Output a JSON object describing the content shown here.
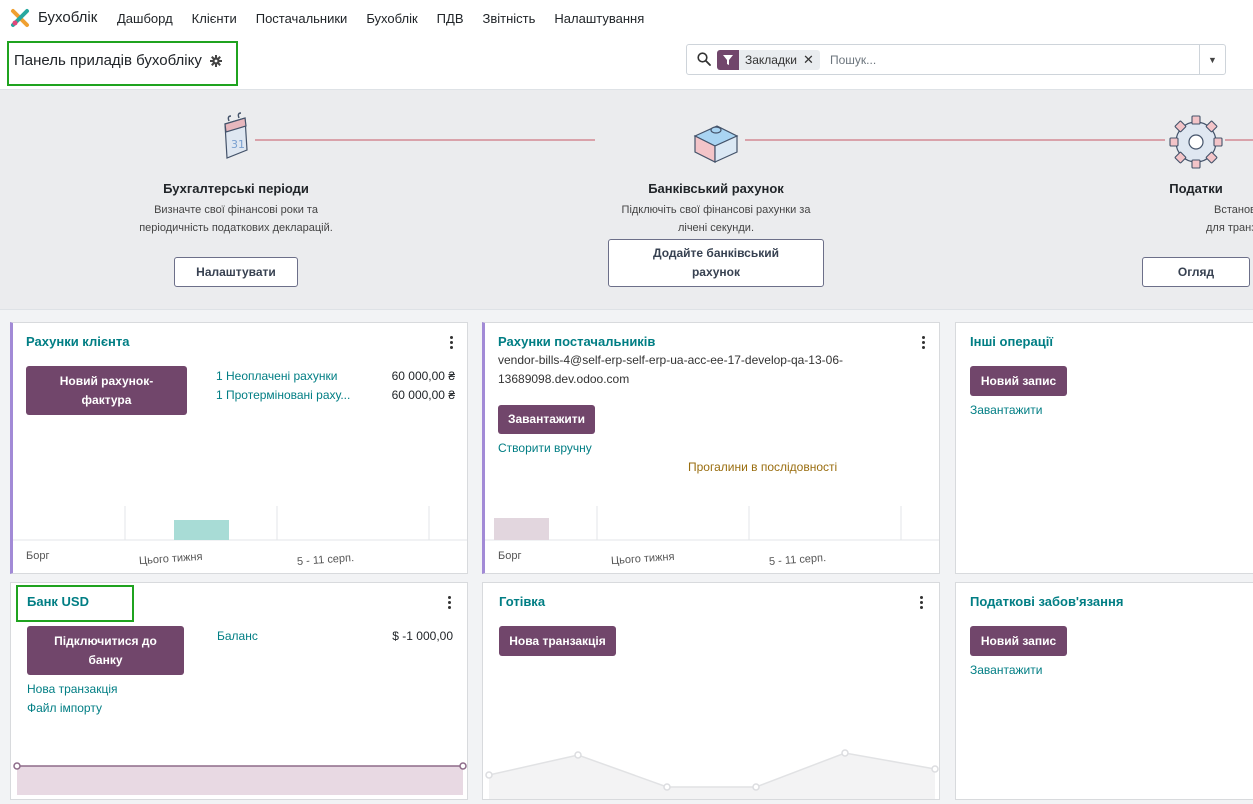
{
  "app": {
    "name": "Бухоблік",
    "menu": [
      "Дашборд",
      "Клієнти",
      "Постачальники",
      "Бухоблік",
      "ПДВ",
      "Звітність",
      "Налаштування"
    ]
  },
  "control": {
    "title": "Панель приладів бухобліку",
    "facet_label": "Закладки",
    "search_placeholder": "Пошук..."
  },
  "onboarding": {
    "steps": [
      {
        "title": "Бухгалтерські періоди",
        "desc1": "Визначте свої фінансові роки та",
        "desc2": "періодичність податкових декларацій.",
        "button": "Налаштувати",
        "icon": "calendar-icon"
      },
      {
        "title": "Банківський рахунок",
        "desc1": "Підключіть свої фінансові рахунки за",
        "desc2": "лічені секунди.",
        "button1": "Додайте банківський",
        "button2": "рахунок",
        "icon": "puzzle-icon"
      },
      {
        "title": "Податки",
        "desc1": "Встановіть податки за замовч",
        "desc2": "для транзакцій продажів та за",
        "button": "Огляд",
        "icon": "gear-icon"
      }
    ]
  },
  "cards": {
    "customer_invoices": {
      "title": "Рахунки клієнта",
      "new_button_1": "Новий рахунок-",
      "new_button_2": "фактура",
      "rows": [
        {
          "label": "1 Неоплачені рахунки",
          "amount": "60 000,00 ₴"
        },
        {
          "label": "1 Протерміновані раху...",
          "amount": "60 000,00 ₴"
        }
      ],
      "chart_labels": [
        "Борг",
        "Цього тижня",
        "5 - 11 серп."
      ]
    },
    "vendor_bills": {
      "title": "Рахунки постачальників",
      "email_1": "vendor-bills-4@self-erp-self-erp-ua-acc-ee-17-develop-qa-13-06-",
      "email_2": "13689098.dev.odoo.com",
      "upload_button": "Завантажити",
      "manual_link": "Створити вручну",
      "warning": "Прогалини в послідовності",
      "chart_labels": [
        "Борг",
        "Цього тижня",
        "5 - 11 серп."
      ]
    },
    "other_ops": {
      "title": "Інші операції",
      "new_button": "Новий запис",
      "upload_link": "Завантажити"
    },
    "bank_usd": {
      "title": "Банк USD",
      "connect_button_1": "Підключитися до",
      "connect_button_2": "банку",
      "balance_label": "Баланс",
      "balance_value": "$ -1 000,00",
      "new_tx_link": "Нова транзакція",
      "import_link": "Файл імпорту"
    },
    "cash": {
      "title": "Готівка",
      "new_tx_button": "Нова транзакція"
    },
    "tax_liab": {
      "title": "Податкові забов'язання",
      "new_button": "Новий запис",
      "upload_link": "Завантажити"
    }
  },
  "colors": {
    "brand": "#71466b",
    "link": "#017e84",
    "accent_border": "#a28ad6",
    "highlight": "#1fa31f"
  }
}
